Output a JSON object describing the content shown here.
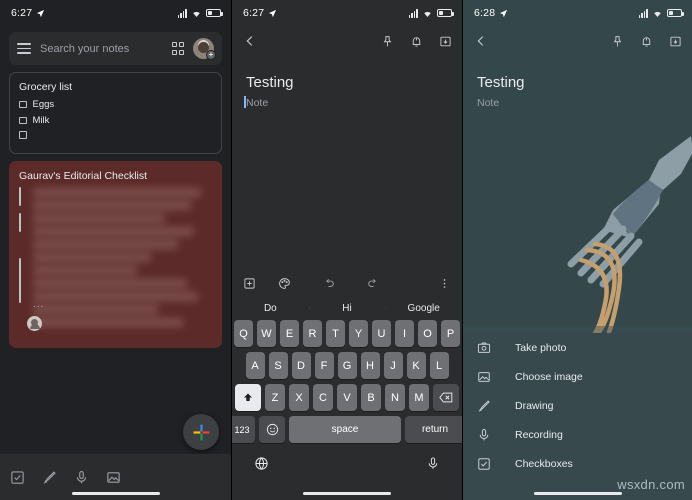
{
  "panel1": {
    "status": {
      "time": "6:27",
      "location_icon": "location-arrow-icon",
      "signal_icon": "signal-bars-icon",
      "wifi_icon": "wifi-icon",
      "battery_icon": "battery-icon"
    },
    "search": {
      "placeholder": "Search your notes",
      "menu_icon": "hamburger-menu-icon",
      "view_icon": "grid-view-icon",
      "avatar_icon": "account-avatar-icon",
      "avatar_badge": "+"
    },
    "notes": [
      {
        "title": "Grocery list",
        "items": [
          {
            "label": "Eggs",
            "checked": false
          },
          {
            "label": "Milk",
            "checked": false
          },
          {
            "label": "",
            "checked": false
          }
        ],
        "color": "#202124"
      },
      {
        "title": "Gaurav's Editorial Checklist",
        "items": [],
        "color": "#5c2b29",
        "blurred": true,
        "overflow_indicator": "...",
        "collaborator_icon": "collaborator-avatar-icon"
      }
    ],
    "bottombar": {
      "icons": [
        "new-checklist-icon",
        "new-drawing-icon",
        "new-recording-icon",
        "new-image-icon"
      ],
      "fab": "create-note-fab"
    }
  },
  "panel2": {
    "status": {
      "time": "6:27"
    },
    "topbar": {
      "back_icon": "back-arrow-icon",
      "pin_icon": "pin-icon",
      "reminder_icon": "reminder-bell-icon",
      "archive_icon": "archive-icon"
    },
    "note": {
      "title": "Testing",
      "body_placeholder": "Note"
    },
    "toolbar": {
      "add_icon": "add-box-icon",
      "palette_icon": "color-palette-icon",
      "undo_icon": "undo-icon",
      "redo_icon": "redo-icon",
      "more_icon": "more-vert-icon"
    },
    "keyboard": {
      "suggestions": [
        "Do",
        "Hi",
        "Google"
      ],
      "row1": [
        "Q",
        "W",
        "E",
        "R",
        "T",
        "Y",
        "U",
        "I",
        "O",
        "P"
      ],
      "row2": [
        "A",
        "S",
        "D",
        "F",
        "G",
        "H",
        "J",
        "K",
        "L"
      ],
      "row3": [
        "Z",
        "X",
        "C",
        "V",
        "B",
        "N",
        "M"
      ],
      "shift_label": "shift-icon",
      "backspace_label": "backspace-icon",
      "numeric_label": "123",
      "emoji_label": "emoji-icon",
      "space_label": "space",
      "return_label": "return",
      "globe_label": "language-globe-icon",
      "mic_label": "voice-input-icon"
    }
  },
  "panel3": {
    "status": {
      "time": "6:28"
    },
    "topbar": {
      "back_icon": "back-arrow-icon",
      "pin_icon": "pin-icon",
      "reminder_icon": "reminder-bell-icon",
      "archive_icon": "archive-icon"
    },
    "note": {
      "title": "Testing",
      "body_placeholder": "Note"
    },
    "background_color": "#34474b",
    "sheet_color": "#37494d",
    "illustration": "fork-with-spaghetti-illustration",
    "sheet": {
      "items": [
        {
          "label": "Take photo",
          "icon": "camera-icon"
        },
        {
          "label": "Choose image",
          "icon": "image-icon"
        },
        {
          "label": "Drawing",
          "icon": "brush-icon"
        },
        {
          "label": "Recording",
          "icon": "microphone-icon"
        },
        {
          "label": "Checkboxes",
          "icon": "checkbox-icon"
        }
      ]
    },
    "watermark": "wsxdn.com"
  }
}
